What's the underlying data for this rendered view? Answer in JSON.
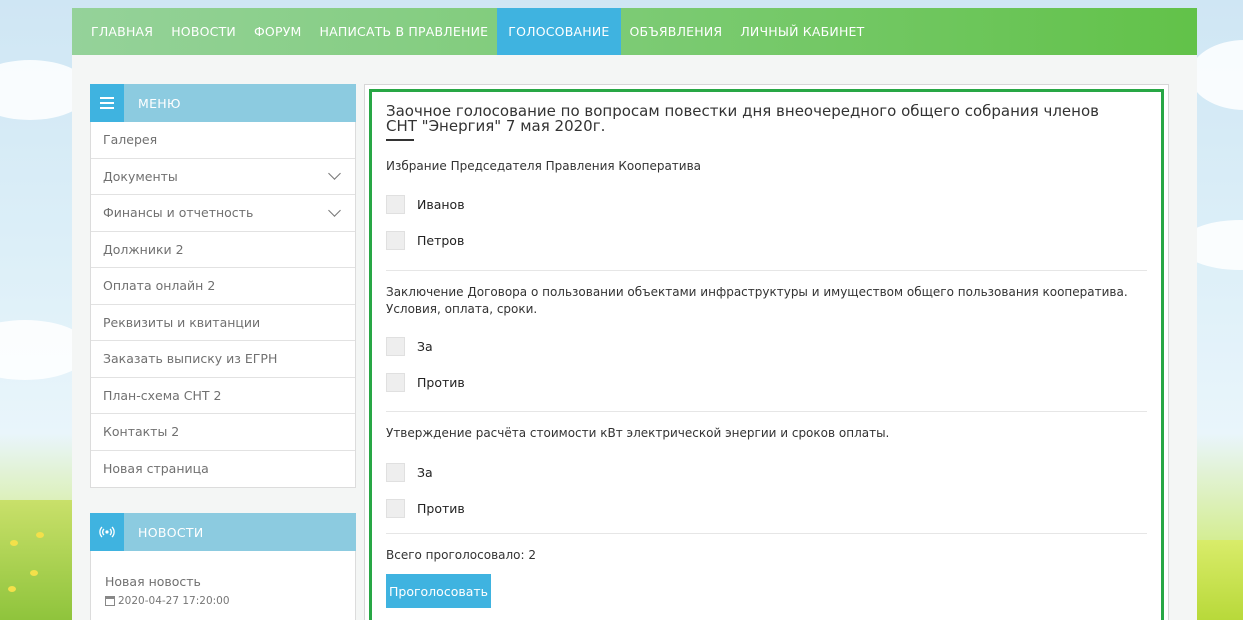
{
  "nav": {
    "items": [
      {
        "label": "ГЛАВНАЯ",
        "active": false
      },
      {
        "label": "НОВОСТИ",
        "active": false
      },
      {
        "label": "ФОРУМ",
        "active": false
      },
      {
        "label": "НАПИСАТЬ В ПРАВЛЕНИЕ",
        "active": false
      },
      {
        "label": "ГОЛОСОВАНИЕ",
        "active": true
      },
      {
        "label": "ОБЪЯВЛЕНИЯ",
        "active": false
      },
      {
        "label": "ЛИЧНЫЙ КАБИНЕТ",
        "active": false
      }
    ]
  },
  "sidebar": {
    "menu_title": "МЕНЮ",
    "menu_icon": "hamburger-icon",
    "items": [
      {
        "label": "Галерея",
        "has_children": false
      },
      {
        "label": "Документы",
        "has_children": true
      },
      {
        "label": "Финансы и отчетность",
        "has_children": true
      },
      {
        "label": "Должники 2",
        "has_children": false
      },
      {
        "label": "Оплата онлайн 2",
        "has_children": false
      },
      {
        "label": "Реквизиты и квитанции",
        "has_children": false
      },
      {
        "label": "Заказать выписку из ЕГРН",
        "has_children": false
      },
      {
        "label": "План-схема СНТ 2",
        "has_children": false
      },
      {
        "label": "Контакты 2",
        "has_children": false
      },
      {
        "label": "Новая страница",
        "has_children": false
      }
    ],
    "news_title": "НОВОСТИ",
    "news_icon": "broadcast-icon",
    "news": {
      "title": "Новая новость",
      "date": "2020-04-27 17:20:00",
      "date_icon": "calendar-icon"
    }
  },
  "poll": {
    "title_line1": "Заочное голосование по вопросам повестки дня внеочередного общего собрания членов",
    "title_line2": "СНТ \"Энергия\" 7 мая 2020г.",
    "questions": [
      {
        "text": "Избрание Председателя Правления Кооператива",
        "options": [
          "Иванов",
          "Петров"
        ]
      },
      {
        "text_line1": "Заключение Договора о пользовании объектами инфраструктуры и имуществом общего пользования кооператива.",
        "text_line2": "Условия, оплата, сроки.",
        "options": [
          "За",
          "Против"
        ]
      },
      {
        "text": "Утверждение расчёта стоимости кВт электрической энергии и сроков оплаты.",
        "options": [
          "За",
          "Против"
        ]
      }
    ],
    "total_label": "Всего проголосовало: 2",
    "vote_button": "Проголосовать",
    "accent_color": "#28a745"
  },
  "colors": {
    "nav_active": "#3fb3e0",
    "button": "#3fb3e0",
    "sidebar_header": "#8ccbe0"
  }
}
